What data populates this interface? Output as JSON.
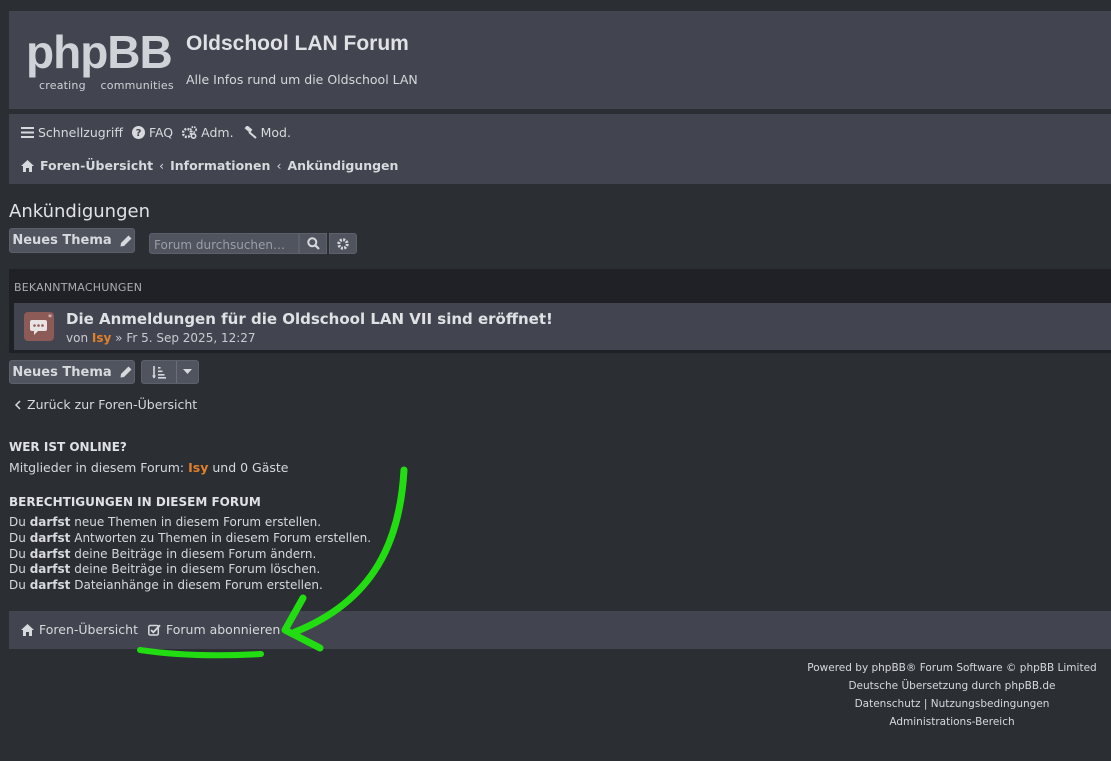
{
  "header": {
    "logo_text": "phpBB",
    "logo_sub": "creating    communities",
    "title": "Oldschool LAN Forum",
    "description": "Alle Infos rund um die Oldschool LAN"
  },
  "nav": {
    "quick": "Schnellzugriff",
    "faq": "FAQ",
    "adm": "Adm.",
    "mod": "Mod."
  },
  "breadcrumbs": [
    "Foren-Übersicht",
    "Informationen",
    "Ankündigungen"
  ],
  "page": {
    "title": "Ankündigungen",
    "new_topic": "Neues Thema",
    "search_placeholder": "Forum durchsuchen…"
  },
  "topics": {
    "header": "BEKANNTMACHUNGEN",
    "items": [
      {
        "title": "Die Anmeldungen für die Oldschool LAN VII sind eröffnet!",
        "by": "von",
        "author": "Isy",
        "date": "» Fr 5. Sep 2025, 12:27"
      }
    ]
  },
  "back_link": "Zurück zur Foren-Übersicht",
  "online": {
    "heading": "WER IST ONLINE?",
    "prefix": "Mitglieder in diesem Forum:",
    "user": "Isy",
    "suffix": "und 0 Gäste"
  },
  "permissions": {
    "heading": "BERECHTIGUNGEN IN DIESEM FORUM",
    "du": "Du",
    "darfst": "darfst",
    "lines": [
      "neue Themen in diesem Forum erstellen.",
      "Antworten zu Themen in diesem Forum erstellen.",
      "deine Beiträge in diesem Forum ändern.",
      "deine Beiträge in diesem Forum löschen.",
      "Dateianhänge in diesem Forum erstellen."
    ]
  },
  "footer": {
    "index": "Foren-Übersicht",
    "subscribe": "Forum abonnieren",
    "powered": "Powered by phpBB® Forum Software © phpBB Limited",
    "translation": "Deutsche Übersetzung durch phpBB.de",
    "privacy": "Datenschutz",
    "separator": "|",
    "terms": "Nutzungsbedingungen",
    "admin": "Administrations-Bereich"
  },
  "colors": {
    "background": "#2b2e33",
    "panel": "#42454f",
    "username": "#e0802b",
    "annotation": "#22dd11"
  }
}
